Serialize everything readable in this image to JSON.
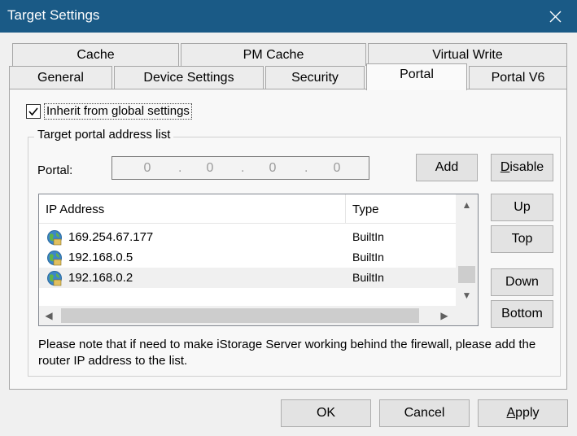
{
  "window": {
    "title": "Target Settings"
  },
  "tabs": {
    "row_back": [
      "Cache",
      "PM Cache",
      "Virtual Write"
    ],
    "row_front": [
      "General",
      "Device Settings",
      "Security",
      "Portal",
      "Portal V6"
    ],
    "active": "Portal"
  },
  "inherit": {
    "label": "Inherit from global settings",
    "checked": true
  },
  "group": {
    "title": "Target portal address list"
  },
  "portal": {
    "label": "Portal:",
    "octets": [
      "0",
      "0",
      "0",
      "0"
    ],
    "dot": "."
  },
  "buttons": {
    "add": "Add",
    "disable_pre": "",
    "disable_mn": "D",
    "disable_post": "isable",
    "up": "Up",
    "top": "Top",
    "down": "Down",
    "bottom": "Bottom",
    "ok": "OK",
    "cancel": "Cancel",
    "apply_mn": "A",
    "apply_post": "pply"
  },
  "list": {
    "columns": [
      "IP Address",
      "Type"
    ],
    "rows": [
      {
        "ip": "169.254.67.177",
        "type": "BuiltIn"
      },
      {
        "ip": "192.168.0.5",
        "type": "BuiltIn"
      },
      {
        "ip": "192.168.0.2",
        "type": "BuiltIn"
      }
    ]
  },
  "note": "Please note that if need to make iStorage Server working behind the firewall, please add the router IP address to the  list.",
  "colors": {
    "titlebar": "#1a5a86",
    "panel": "#f8f8f8",
    "button": "#e3e3e3"
  },
  "icons": {
    "row_icon": "network-globe-icon",
    "close": "close-icon"
  }
}
